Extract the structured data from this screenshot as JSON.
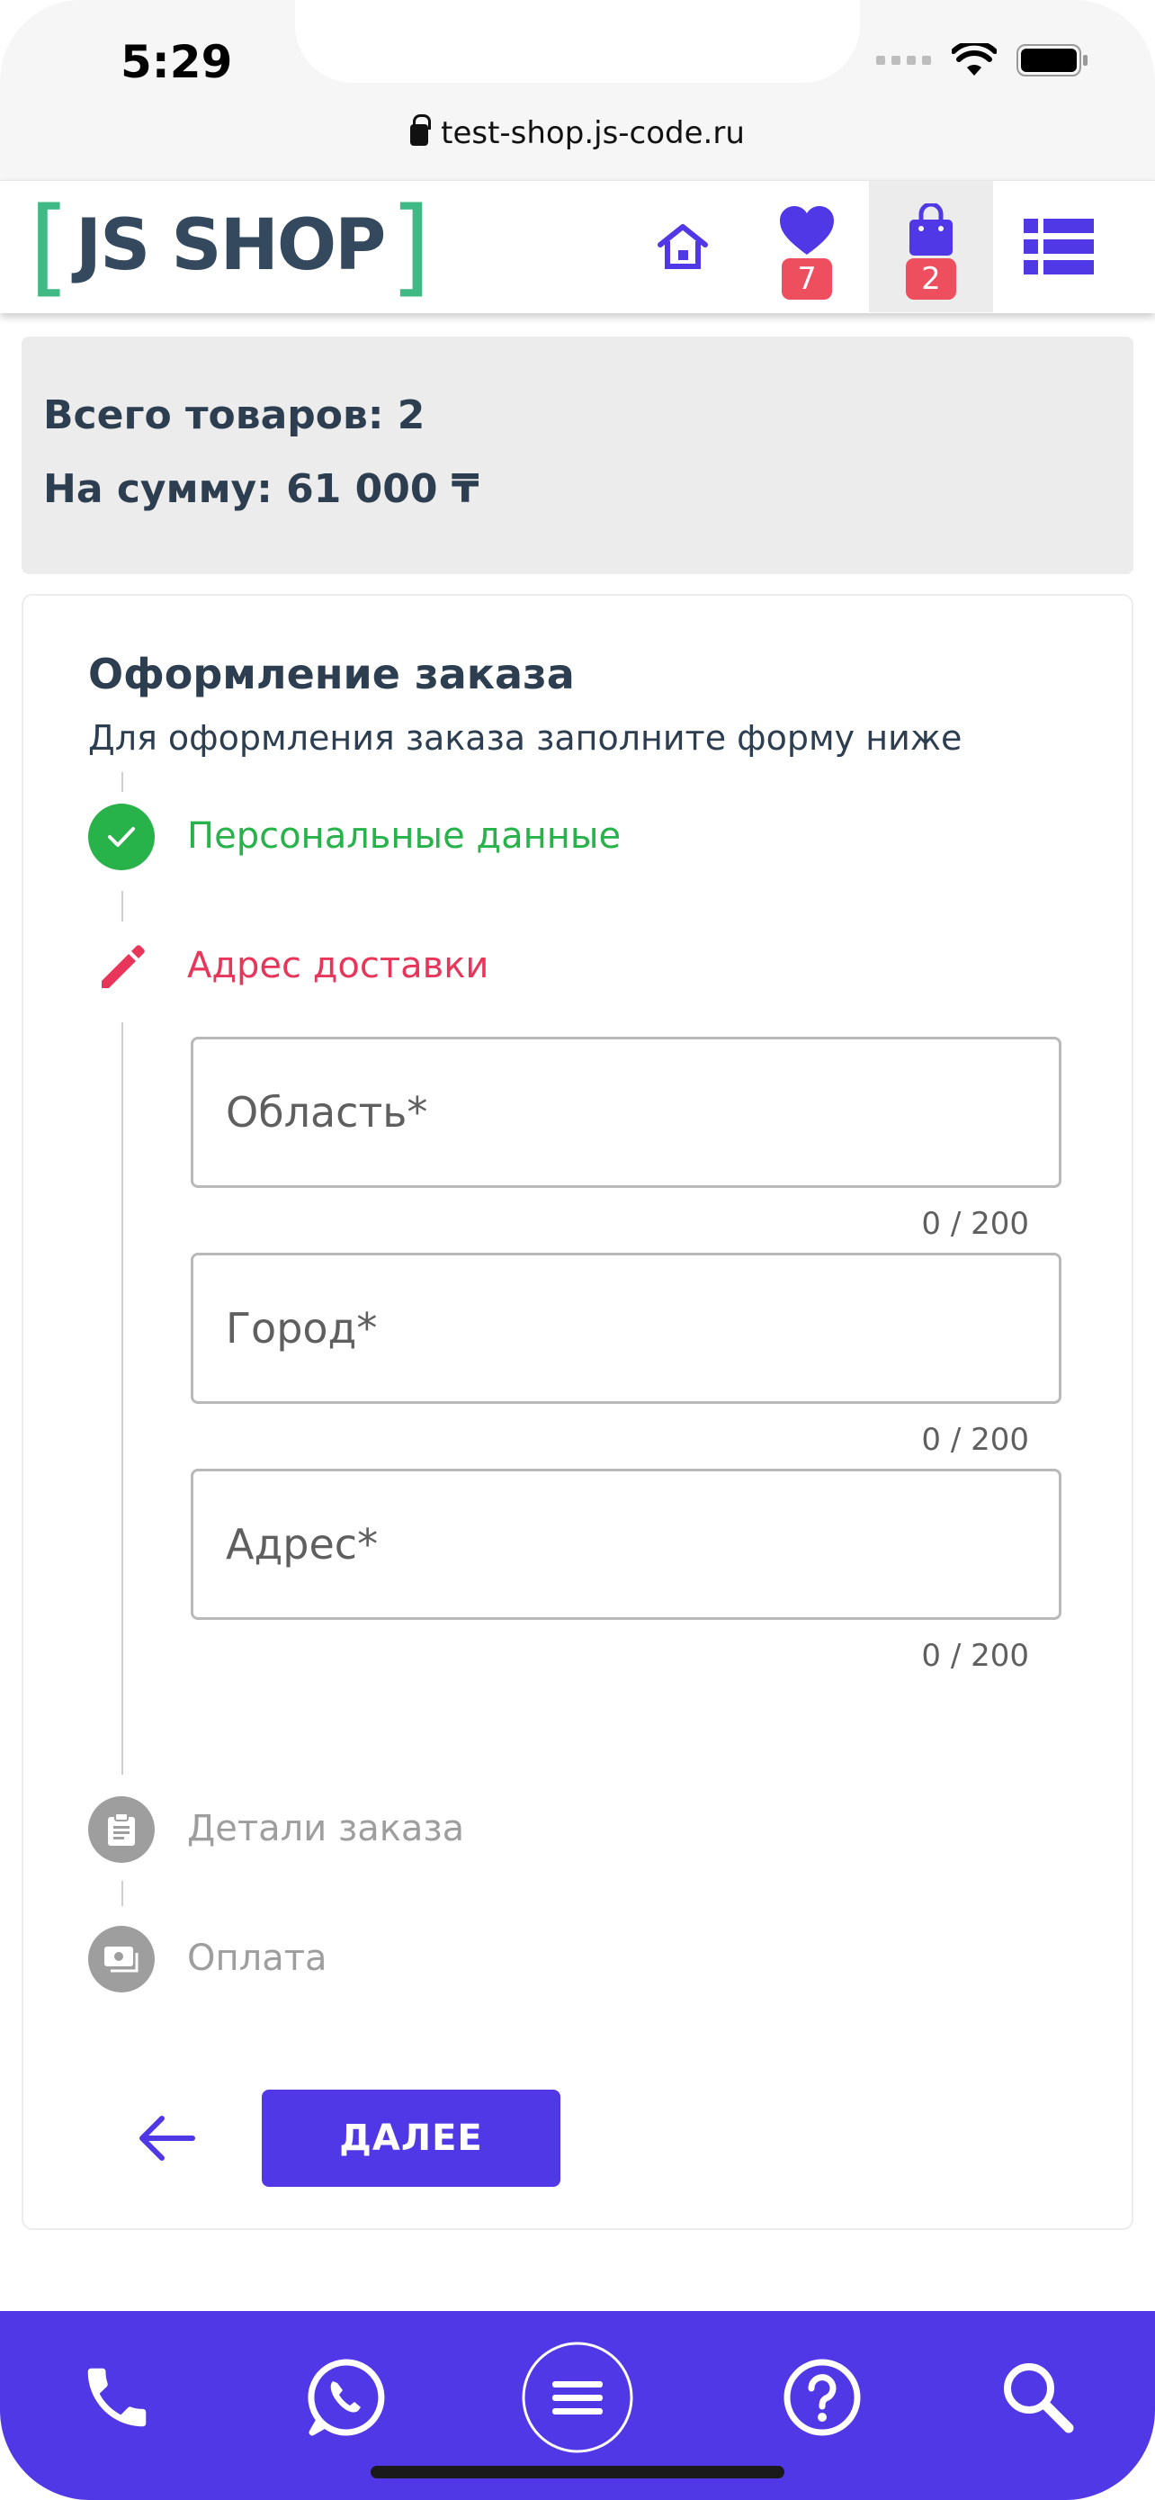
{
  "status_bar": {
    "time": "5:29"
  },
  "browser": {
    "url": "test-shop.js-code.ru"
  },
  "header": {
    "logo_text": "JS SHOP",
    "logo_bracket_left": "[",
    "logo_bracket_right": "]",
    "favorites_count": "7",
    "cart_count": "2",
    "accent_color": "#5138e6",
    "badge_color": "#ed4f5f"
  },
  "summary": {
    "total_items": "Всего товаров: 2",
    "total_sum": "На сумму: 61 000 ₸"
  },
  "checkout": {
    "title": "Оформление заказа",
    "subtitle": "Для оформления заказа заполните форму ниже",
    "steps": [
      {
        "label": "Персональные данные",
        "state": "done",
        "color": "#27b24a"
      },
      {
        "label": "Адрес доставки",
        "state": "active",
        "color": "#e8365a"
      },
      {
        "label": "Детали заказа",
        "state": "pending",
        "color": "#9e9e9e"
      },
      {
        "label": "Оплата",
        "state": "pending",
        "color": "#9e9e9e"
      }
    ],
    "fields": [
      {
        "placeholder": "Область*",
        "value": "",
        "counter": "0 / 200"
      },
      {
        "placeholder": "Город*",
        "value": "",
        "counter": "0 / 200"
      },
      {
        "placeholder": "Адрес*",
        "value": "",
        "counter": "0 / 200"
      }
    ],
    "next_label": "ДАЛЕЕ"
  },
  "bottom_bar": {
    "icons": [
      "phone-icon",
      "whatsapp-icon",
      "menu-icon",
      "help-icon",
      "search-icon"
    ]
  }
}
